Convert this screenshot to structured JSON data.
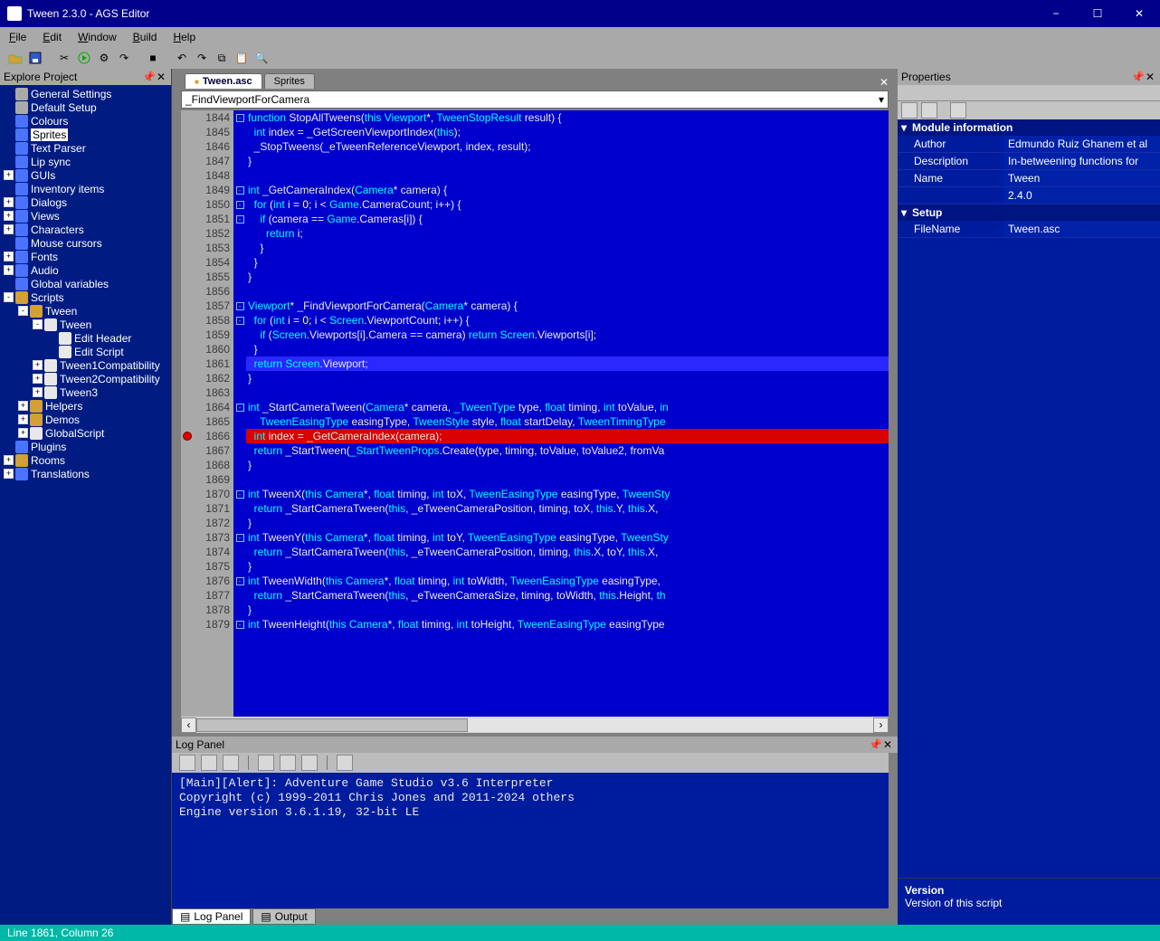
{
  "title": "Tween 2.3.0 - AGS Editor",
  "menu": {
    "file": "File",
    "edit": "Edit",
    "window": "Window",
    "build": "Build",
    "help": "Help"
  },
  "tabs": [
    "Tween.asc",
    "Sprites"
  ],
  "activeTab": 0,
  "functionCombo": "_FindViewportForCamera",
  "explore": {
    "title": "Explore Project",
    "items": [
      {
        "depth": 0,
        "exp": "",
        "icon": "gear",
        "label": "General Settings"
      },
      {
        "depth": 0,
        "exp": "",
        "icon": "gear",
        "label": "Default Setup"
      },
      {
        "depth": 0,
        "exp": "",
        "icon": "blue",
        "label": "Colours"
      },
      {
        "depth": 0,
        "exp": "",
        "icon": "blue",
        "label": "Sprites",
        "sel": true
      },
      {
        "depth": 0,
        "exp": "",
        "icon": "blue",
        "label": "Text Parser"
      },
      {
        "depth": 0,
        "exp": "",
        "icon": "blue",
        "label": "Lip sync"
      },
      {
        "depth": 0,
        "exp": "+",
        "icon": "blue",
        "label": "GUIs"
      },
      {
        "depth": 0,
        "exp": "",
        "icon": "blue",
        "label": "Inventory items"
      },
      {
        "depth": 0,
        "exp": "+",
        "icon": "blue",
        "label": "Dialogs"
      },
      {
        "depth": 0,
        "exp": "+",
        "icon": "blue",
        "label": "Views"
      },
      {
        "depth": 0,
        "exp": "+",
        "icon": "blue",
        "label": "Characters"
      },
      {
        "depth": 0,
        "exp": "",
        "icon": "blue",
        "label": "Mouse cursors"
      },
      {
        "depth": 0,
        "exp": "+",
        "icon": "blue",
        "label": "Fonts"
      },
      {
        "depth": 0,
        "exp": "+",
        "icon": "blue",
        "label": "Audio"
      },
      {
        "depth": 0,
        "exp": "",
        "icon": "blue",
        "label": "Global variables"
      },
      {
        "depth": 0,
        "exp": "-",
        "icon": "folder",
        "label": "Scripts"
      },
      {
        "depth": 1,
        "exp": "-",
        "icon": "folder",
        "label": "Tween"
      },
      {
        "depth": 2,
        "exp": "-",
        "icon": "script",
        "label": "Tween"
      },
      {
        "depth": 3,
        "exp": "",
        "icon": "script",
        "label": "Edit Header"
      },
      {
        "depth": 3,
        "exp": "",
        "icon": "script",
        "label": "Edit Script"
      },
      {
        "depth": 2,
        "exp": "+",
        "icon": "script",
        "label": "Tween1Compatibility"
      },
      {
        "depth": 2,
        "exp": "+",
        "icon": "script",
        "label": "Tween2Compatibility"
      },
      {
        "depth": 2,
        "exp": "+",
        "icon": "script",
        "label": "Tween3"
      },
      {
        "depth": 1,
        "exp": "+",
        "icon": "folder",
        "label": "Helpers"
      },
      {
        "depth": 1,
        "exp": "+",
        "icon": "folder",
        "label": "Demos"
      },
      {
        "depth": 1,
        "exp": "+",
        "icon": "script",
        "label": "GlobalScript"
      },
      {
        "depth": 0,
        "exp": "",
        "icon": "blue",
        "label": "Plugins"
      },
      {
        "depth": 0,
        "exp": "+",
        "icon": "folder",
        "label": "Rooms"
      },
      {
        "depth": 0,
        "exp": "+",
        "icon": "blue",
        "label": "Translations"
      }
    ]
  },
  "code": {
    "start": 1844,
    "breakpointAt": 1866,
    "highlightAt": 1866,
    "cursorAt": 1861,
    "lines": [
      {
        "fold": "-",
        "html": "<span class='kw'>function</span> StopAllTweens(<span class='kw'>this</span> <span class='ty'>Viewport</span>*, <span class='ty'>TweenStopResult</span> result) {"
      },
      {
        "fold": "",
        "html": "  <span class='kw'>int</span> index = _GetScreenViewportIndex(<span class='kw'>this</span>);"
      },
      {
        "fold": "",
        "html": "  _StopTweens(_eTweenReferenceViewport, index, result);"
      },
      {
        "fold": "",
        "html": "}"
      },
      {
        "fold": "",
        "html": ""
      },
      {
        "fold": "-",
        "html": "<span class='kw'>int</span> _GetCameraIndex(<span class='ty'>Camera</span>* camera) {"
      },
      {
        "fold": "-",
        "html": "  <span class='kw'>for</span> (<span class='kw'>int</span> i = <span class='nm'>0</span>; i &lt; <span class='ty'>Game</span>.CameraCount; i++) {"
      },
      {
        "fold": "-",
        "html": "    <span class='kw'>if</span> (camera == <span class='ty'>Game</span>.Cameras[i]) {"
      },
      {
        "fold": "",
        "html": "      <span class='kw'>return</span> i;"
      },
      {
        "fold": "",
        "html": "    }"
      },
      {
        "fold": "",
        "html": "  }"
      },
      {
        "fold": "",
        "html": "}"
      },
      {
        "fold": "",
        "html": ""
      },
      {
        "fold": "-",
        "html": "<span class='ty'>Viewport</span>* _FindViewportForCamera(<span class='ty'>Camera</span>* camera) {"
      },
      {
        "fold": "-",
        "html": "  <span class='kw'>for</span> (<span class='kw'>int</span> i = <span class='nm'>0</span>; i &lt; <span class='ty'>Screen</span>.ViewportCount; i++) {"
      },
      {
        "fold": "",
        "html": "    <span class='kw'>if</span> (<span class='ty'>Screen</span>.Viewports[i].Camera == camera) <span class='kw'>return</span> <span class='ty'>Screen</span>.Viewports[i];"
      },
      {
        "fold": "",
        "html": "  }"
      },
      {
        "fold": "",
        "html": "  <span class='kw'>return</span> <span class='ty'>Screen</span>.Viewport;"
      },
      {
        "fold": "",
        "html": "}"
      },
      {
        "fold": "",
        "html": ""
      },
      {
        "fold": "-",
        "html": "<span class='kw'>int</span> _StartCameraTween(<span class='ty'>Camera</span>* camera, <span class='ty'>_TweenType</span> type, <span class='kw'>float</span> timing, <span class='kw'>int</span> toValue, <span class='kw'>in</span>"
      },
      {
        "fold": "",
        "html": "    <span class='ty'>TweenEasingType</span> easingType, <span class='ty'>TweenStyle</span> style, <span class='kw'>float</span> startDelay, <span class='ty'>TweenTimingType</span> "
      },
      {
        "fold": "",
        "html": "  <span class='kw'>int</span> index = _GetCameraIndex(camera);"
      },
      {
        "fold": "",
        "html": "  <span class='kw'>return</span> _StartTween(<span class='ty'>_StartTweenProps</span>.Create(type, timing, toValue, toValue2, fromVa"
      },
      {
        "fold": "",
        "html": "}"
      },
      {
        "fold": "",
        "html": ""
      },
      {
        "fold": "-",
        "html": "<span class='kw'>int</span> TweenX(<span class='kw'>this</span> <span class='ty'>Camera</span>*, <span class='kw'>float</span> timing, <span class='kw'>int</span> toX, <span class='ty'>TweenEasingType</span> easingType, <span class='ty'>TweenSty</span>"
      },
      {
        "fold": "",
        "html": "  <span class='kw'>return</span> _StartCameraTween(<span class='kw'>this</span>, _eTweenCameraPosition, timing, toX, <span class='kw'>this</span>.Y, <span class='kw'>this</span>.X,"
      },
      {
        "fold": "",
        "html": "}"
      },
      {
        "fold": "-",
        "html": "<span class='kw'>int</span> TweenY(<span class='kw'>this</span> <span class='ty'>Camera</span>*, <span class='kw'>float</span> timing, <span class='kw'>int</span> toY, <span class='ty'>TweenEasingType</span> easingType, <span class='ty'>TweenSty</span>"
      },
      {
        "fold": "",
        "html": "  <span class='kw'>return</span> _StartCameraTween(<span class='kw'>this</span>, _eTweenCameraPosition, timing, <span class='kw'>this</span>.X, toY, <span class='kw'>this</span>.X,"
      },
      {
        "fold": "",
        "html": "}"
      },
      {
        "fold": "-",
        "html": "<span class='kw'>int</span> TweenWidth(<span class='kw'>this</span> <span class='ty'>Camera</span>*, <span class='kw'>float</span> timing, <span class='kw'>int</span> toWidth, <span class='ty'>TweenEasingType</span> easingType,"
      },
      {
        "fold": "",
        "html": "  <span class='kw'>return</span> _StartCameraTween(<span class='kw'>this</span>, _eTweenCameraSize, timing, toWidth, <span class='kw'>this</span>.Height, <span class='kw'>th</span>"
      },
      {
        "fold": "",
        "html": "}"
      },
      {
        "fold": "-",
        "html": "<span class='kw'>int</span> TweenHeight(<span class='kw'>this</span> <span class='ty'>Camera</span>*, <span class='kw'>float</span> timing, <span class='kw'>int</span> toHeight, <span class='ty'>TweenEasingType</span> easingType"
      }
    ]
  },
  "log": {
    "title": "Log Panel",
    "lines": [
      "[Main][Alert]: Adventure Game Studio v3.6 Interpreter",
      "Copyright (c) 1999-2011 Chris Jones and 2011-2024 others",
      "Engine version 3.6.1.19, 32-bit LE"
    ],
    "tabs": [
      "Log Panel",
      "Output"
    ],
    "activeTab": 0
  },
  "properties": {
    "title": "Properties",
    "sections": [
      {
        "name": "Module information",
        "rows": [
          {
            "k": "Author",
            "v": "Edmundo Ruiz Ghanem et al"
          },
          {
            "k": "Description",
            "v": "In-betweening functions for"
          },
          {
            "k": "Name",
            "v": "Tween"
          },
          {
            "k": "",
            "v": "2.4.0"
          }
        ]
      },
      {
        "name": "Setup",
        "rows": [
          {
            "k": "FileName",
            "v": "Tween.asc"
          }
        ]
      }
    ],
    "desc": {
      "title": "Version",
      "body": "Version of this script"
    }
  },
  "status": "Line 1861, Column 26"
}
